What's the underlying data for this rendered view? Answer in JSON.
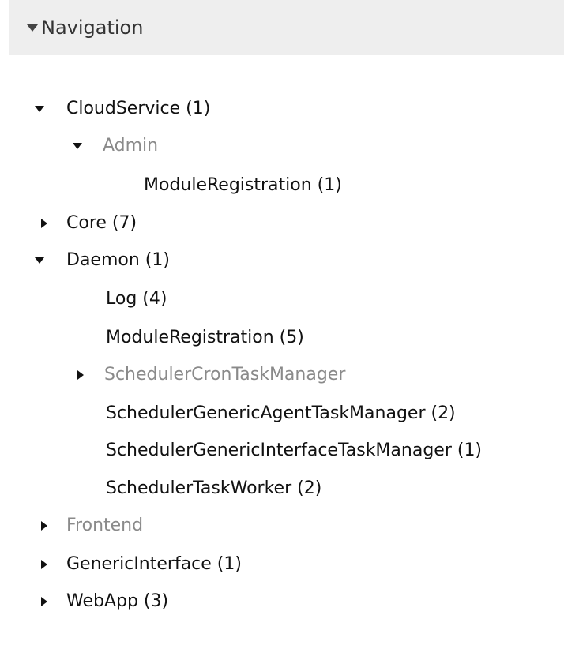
{
  "navigation": {
    "title": "Navigation",
    "items": [
      {
        "label": "CloudService (1)"
      },
      {
        "label": "Admin"
      },
      {
        "label": "ModuleRegistration (1)"
      },
      {
        "label": "Core (7)"
      },
      {
        "label": "Daemon (1)"
      },
      {
        "label": "Log (4)"
      },
      {
        "label": "ModuleRegistration (5)"
      },
      {
        "label": "SchedulerCronTaskManager"
      },
      {
        "label": "SchedulerGenericAgentTaskManager (2)"
      },
      {
        "label": "SchedulerGenericInterfaceTaskManager (1)"
      },
      {
        "label": "SchedulerTaskWorker (2)"
      },
      {
        "label": "Frontend"
      },
      {
        "label": "GenericInterface (1)"
      },
      {
        "label": "WebApp (3)"
      }
    ]
  },
  "icons": {
    "expanded": "caret-down-icon",
    "collapsed": "caret-right-icon"
  },
  "colors": {
    "header_bg": "#eeeeee",
    "text_dark": "#111111",
    "text_muted": "#8a8a8a"
  }
}
